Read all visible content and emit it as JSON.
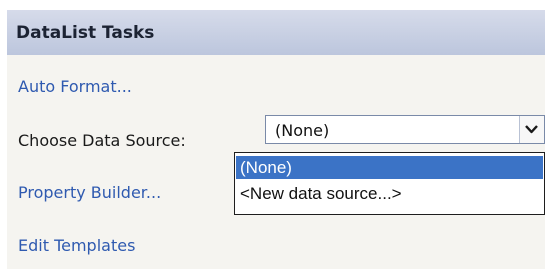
{
  "panel": {
    "title": "DataList Tasks",
    "auto_format": "Auto Format...",
    "choose_data_source_label": "Choose Data Source:",
    "property_builder": "Property Builder...",
    "edit_templates": "Edit Templates"
  },
  "data_source_select": {
    "selected": "(None)",
    "options": [
      "(None)",
      "<New data source...>"
    ],
    "highlighted_option": "(None)"
  },
  "colors": {
    "link": "#2f5ab0",
    "title_bar": "#bcc6dd",
    "highlight": "#3b73c6"
  }
}
